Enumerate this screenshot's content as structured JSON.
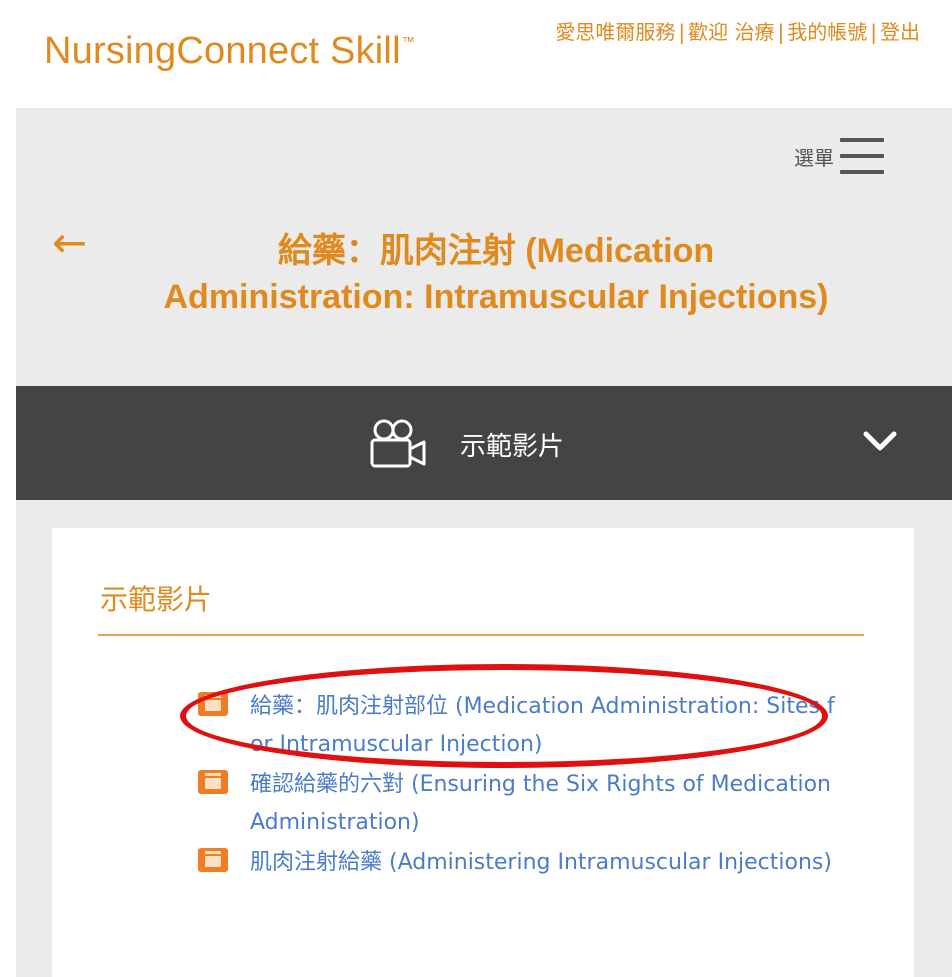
{
  "header": {
    "logo": "NursingConnect Skill",
    "logo_tm": "™",
    "links": [
      {
        "label": "愛思唯爾服務"
      },
      {
        "label": "歡迎 治療"
      },
      {
        "label": "我的帳號"
      },
      {
        "label": "登出"
      }
    ]
  },
  "menubar": {
    "menu_label": "選單",
    "menu_icon": "hamburger-icon"
  },
  "page": {
    "back_icon": "arrow-left-icon",
    "title": "給藥：肌肉注射 (Medication Administration: Intramuscular Injections)"
  },
  "section_bar": {
    "icon": "video-camera-icon",
    "label": "示範影片",
    "toggle_icon": "chevron-down-icon"
  },
  "card": {
    "title": "示範影片",
    "videos": [
      {
        "label": "給藥：肌肉注射部位 (Medication Administration: Sites for Intramuscular Injection)",
        "icon": "video-file-icon"
      },
      {
        "label": "確認給藥的六對 (Ensuring the Six Rights of Medication Administration)",
        "icon": "video-file-icon"
      },
      {
        "label": "肌肉注射給藥 (Administering Intramuscular Injections)",
        "icon": "video-file-icon"
      }
    ]
  },
  "colors": {
    "accent": "#e08a1e",
    "link": "#4a7cc9",
    "section_bar": "#444444",
    "panel": "#ebebeb",
    "annotation": "#e01010"
  }
}
